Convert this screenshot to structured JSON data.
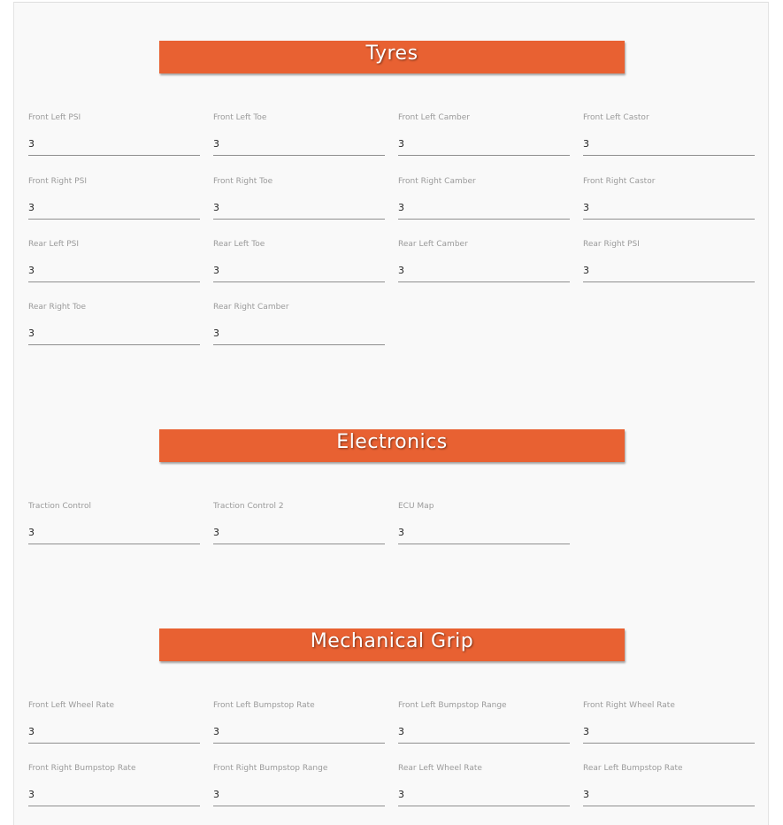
{
  "sections": {
    "tyres": {
      "title": "Tyres",
      "fields": [
        {
          "label": "Front Left PSI",
          "value": "3"
        },
        {
          "label": "Front Left Toe",
          "value": "3"
        },
        {
          "label": "Front Left Camber",
          "value": "3"
        },
        {
          "label": "Front Left Castor",
          "value": "3"
        },
        {
          "label": "Front Right PSI",
          "value": "3"
        },
        {
          "label": "Front Right Toe",
          "value": "3"
        },
        {
          "label": "Front Right Camber",
          "value": "3"
        },
        {
          "label": "Front Right Castor",
          "value": "3"
        },
        {
          "label": "Rear Left PSI",
          "value": "3"
        },
        {
          "label": "Rear Left Toe",
          "value": "3"
        },
        {
          "label": "Rear Left Camber",
          "value": "3"
        },
        {
          "label": "Rear Right PSI",
          "value": "3"
        },
        {
          "label": "Rear Right Toe",
          "value": "3"
        },
        {
          "label": "Rear Right Camber",
          "value": "3"
        }
      ]
    },
    "electronics": {
      "title": "Electronics",
      "fields": [
        {
          "label": "Traction Control",
          "value": "3"
        },
        {
          "label": "Traction Control 2",
          "value": "3"
        },
        {
          "label": "ECU Map",
          "value": "3"
        }
      ]
    },
    "mechanical_grip": {
      "title": "Mechanical Grip",
      "fields": [
        {
          "label": "Front Left Wheel Rate",
          "value": "3"
        },
        {
          "label": "Front Left Bumpstop Rate",
          "value": "3"
        },
        {
          "label": "Front Left Bumpstop Range",
          "value": "3"
        },
        {
          "label": "Front Right Wheel Rate",
          "value": "3"
        },
        {
          "label": "Front Right Bumpstop Rate",
          "value": "3"
        },
        {
          "label": "Front Right Bumpstop Range",
          "value": "3"
        },
        {
          "label": "Rear Left Wheel Rate",
          "value": "3"
        },
        {
          "label": "Rear Left Bumpstop Rate",
          "value": "3"
        }
      ]
    }
  },
  "colors": {
    "header_bg": "#e86132",
    "header_text": "#ffffff",
    "panel_bg": "#f9f9f9",
    "label_text": "#9a9a9a",
    "underline": "#8f8f8f"
  }
}
